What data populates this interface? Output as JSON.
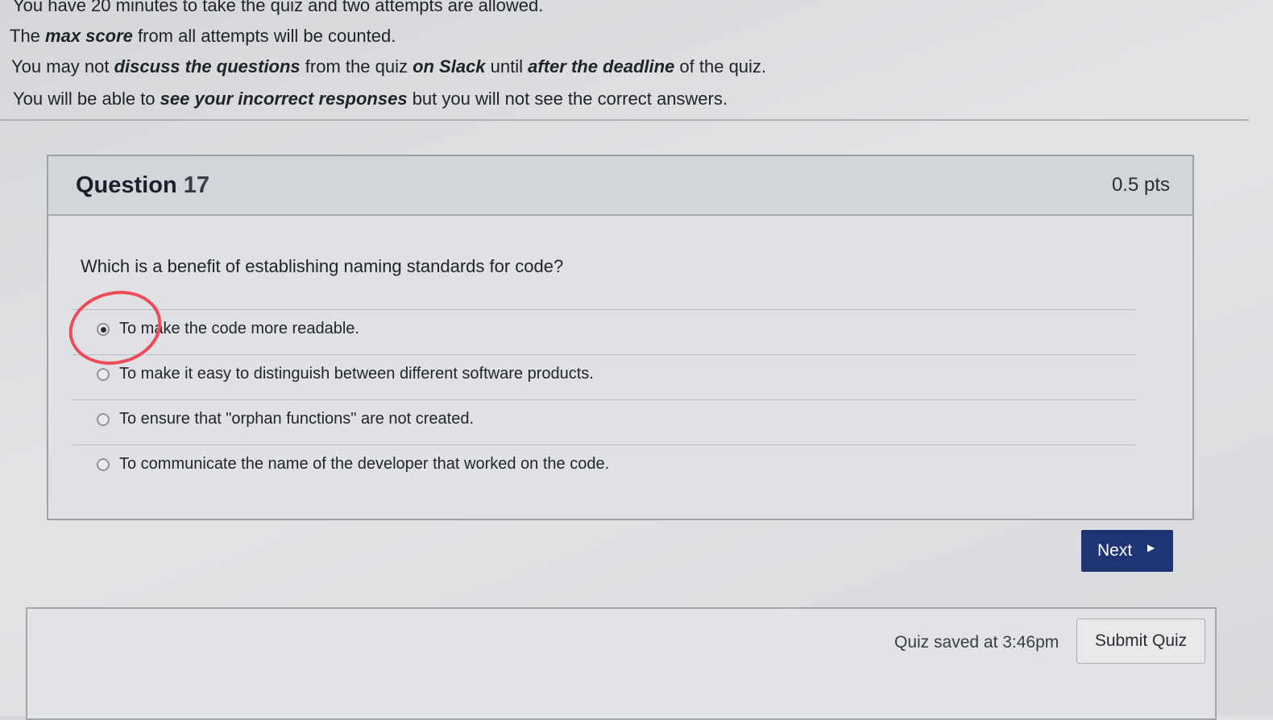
{
  "instructions": {
    "line1": "You have 20 minutes to take the quiz and two attempts are allowed.",
    "line2_a": "The ",
    "line2_b": "max score",
    "line2_c": " from all attempts will be counted.",
    "line3_a": "You may not ",
    "line3_b": "discuss the questions",
    "line3_c": " from the quiz ",
    "line3_d": "on Slack",
    "line3_e": " until ",
    "line3_f": "after the deadline",
    "line3_g": " of the quiz.",
    "line4_a": "You will be able to ",
    "line4_b": "see your incorrect responses",
    "line4_c": " but you will not see the correct answers."
  },
  "question": {
    "label": "Question",
    "number": "17",
    "points": "0.5 pts",
    "text": "Which is a benefit of establishing naming standards for code?",
    "answers": [
      {
        "label": "To make the code more readable.",
        "selected": true
      },
      {
        "label": "To make it easy to distinguish between different software products.",
        "selected": false
      },
      {
        "label": "To ensure that \"orphan functions\" are not created.",
        "selected": false
      },
      {
        "label": "To communicate the name of the developer that worked on the code.",
        "selected": false
      }
    ]
  },
  "nav": {
    "next_label": "Next",
    "next_icon": "triangle-right-icon"
  },
  "footer": {
    "saved_text": "Quiz saved at 3:46pm",
    "submit_label": "Submit Quiz"
  },
  "colors": {
    "primary_button": "#1f3474",
    "annotation_circle": "#ee4a5a"
  }
}
